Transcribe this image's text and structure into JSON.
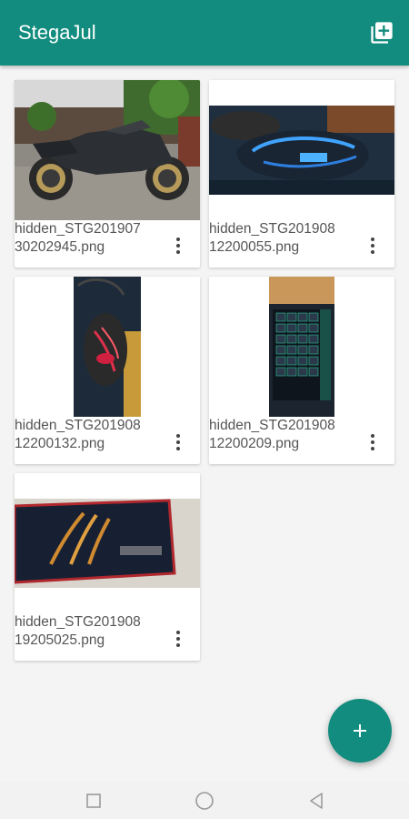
{
  "app": {
    "title": "StegaJul",
    "accent_color": "#128C7E",
    "add_photo_icon": "add-to-photos-icon"
  },
  "images": [
    {
      "line1": "hidden_STG201907",
      "line2": "30202945.png",
      "thumbnail": "motorcycle"
    },
    {
      "line1": "hidden_STG201908",
      "line2": "12200055.png",
      "thumbnail": "gaming-mouse-blue"
    },
    {
      "line1": "hidden_STG201908",
      "line2": "12200132.png",
      "thumbnail": "gaming-mouse-red"
    },
    {
      "line1": "hidden_STG201908",
      "line2": "12200209.png",
      "thumbnail": "keyboard"
    },
    {
      "line1": "hidden_STG201908",
      "line2": "19205025.png",
      "thumbnail": "mousepad"
    }
  ],
  "fab": {
    "icon": "plus-icon"
  },
  "navbar": {
    "icons": [
      "recent-apps-icon",
      "home-icon",
      "back-icon"
    ]
  }
}
